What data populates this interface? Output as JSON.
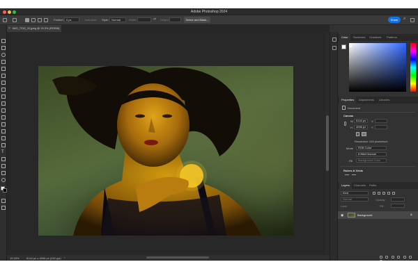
{
  "app": {
    "title": "Adobe Photoshop 2024"
  },
  "options_bar": {
    "feather_label": "Feather:",
    "feather_value": "0 px",
    "anti_alias_label": "Anti-alias",
    "style_label": "Style:",
    "style_value": "Normal",
    "width_label": "Width:",
    "height_label": "Height:",
    "select_mask_label": "Select and Mask...",
    "share_label": "Share"
  },
  "document": {
    "tab_title": "IMG_7232_10.jpeg @ 15.3% (RGB/8)",
    "zoom": "15.33%",
    "dimensions": "6144 px x 4096 px (240 ppi)"
  },
  "panels": {
    "color_tabs": [
      "Color",
      "Swatches",
      "Gradients",
      "Patterns"
    ],
    "properties_tabs": [
      "Properties",
      "Adjustments",
      "Libraries"
    ],
    "document_label": "Document",
    "canvas_title": "Canvas",
    "w_label": "W",
    "w_value": "6144 px",
    "h_label": "H",
    "h_value": "4096 px",
    "x_label": "X",
    "y_label": "Y",
    "resolution": "Resolution: 240 pixels/inch",
    "mode_label": "Mode",
    "mode_value": "RGB Color",
    "bits_value": "8 Bits/Channel",
    "fill_label": "Fill",
    "fill_value": "Background Color",
    "rulers_title": "Rulers & Grids",
    "layers_tabs": [
      "Layers",
      "Channels",
      "Paths"
    ],
    "kind_label": "Kind",
    "mode_normal": "Normal",
    "opacity_label": "Opacity:",
    "lock_label": "Lock:",
    "fill2_label": "Fill:",
    "layer_name": "Background"
  },
  "colors": {
    "accent": "#1473e6",
    "panel_bg": "#323232",
    "canvas_bg": "#282828"
  }
}
